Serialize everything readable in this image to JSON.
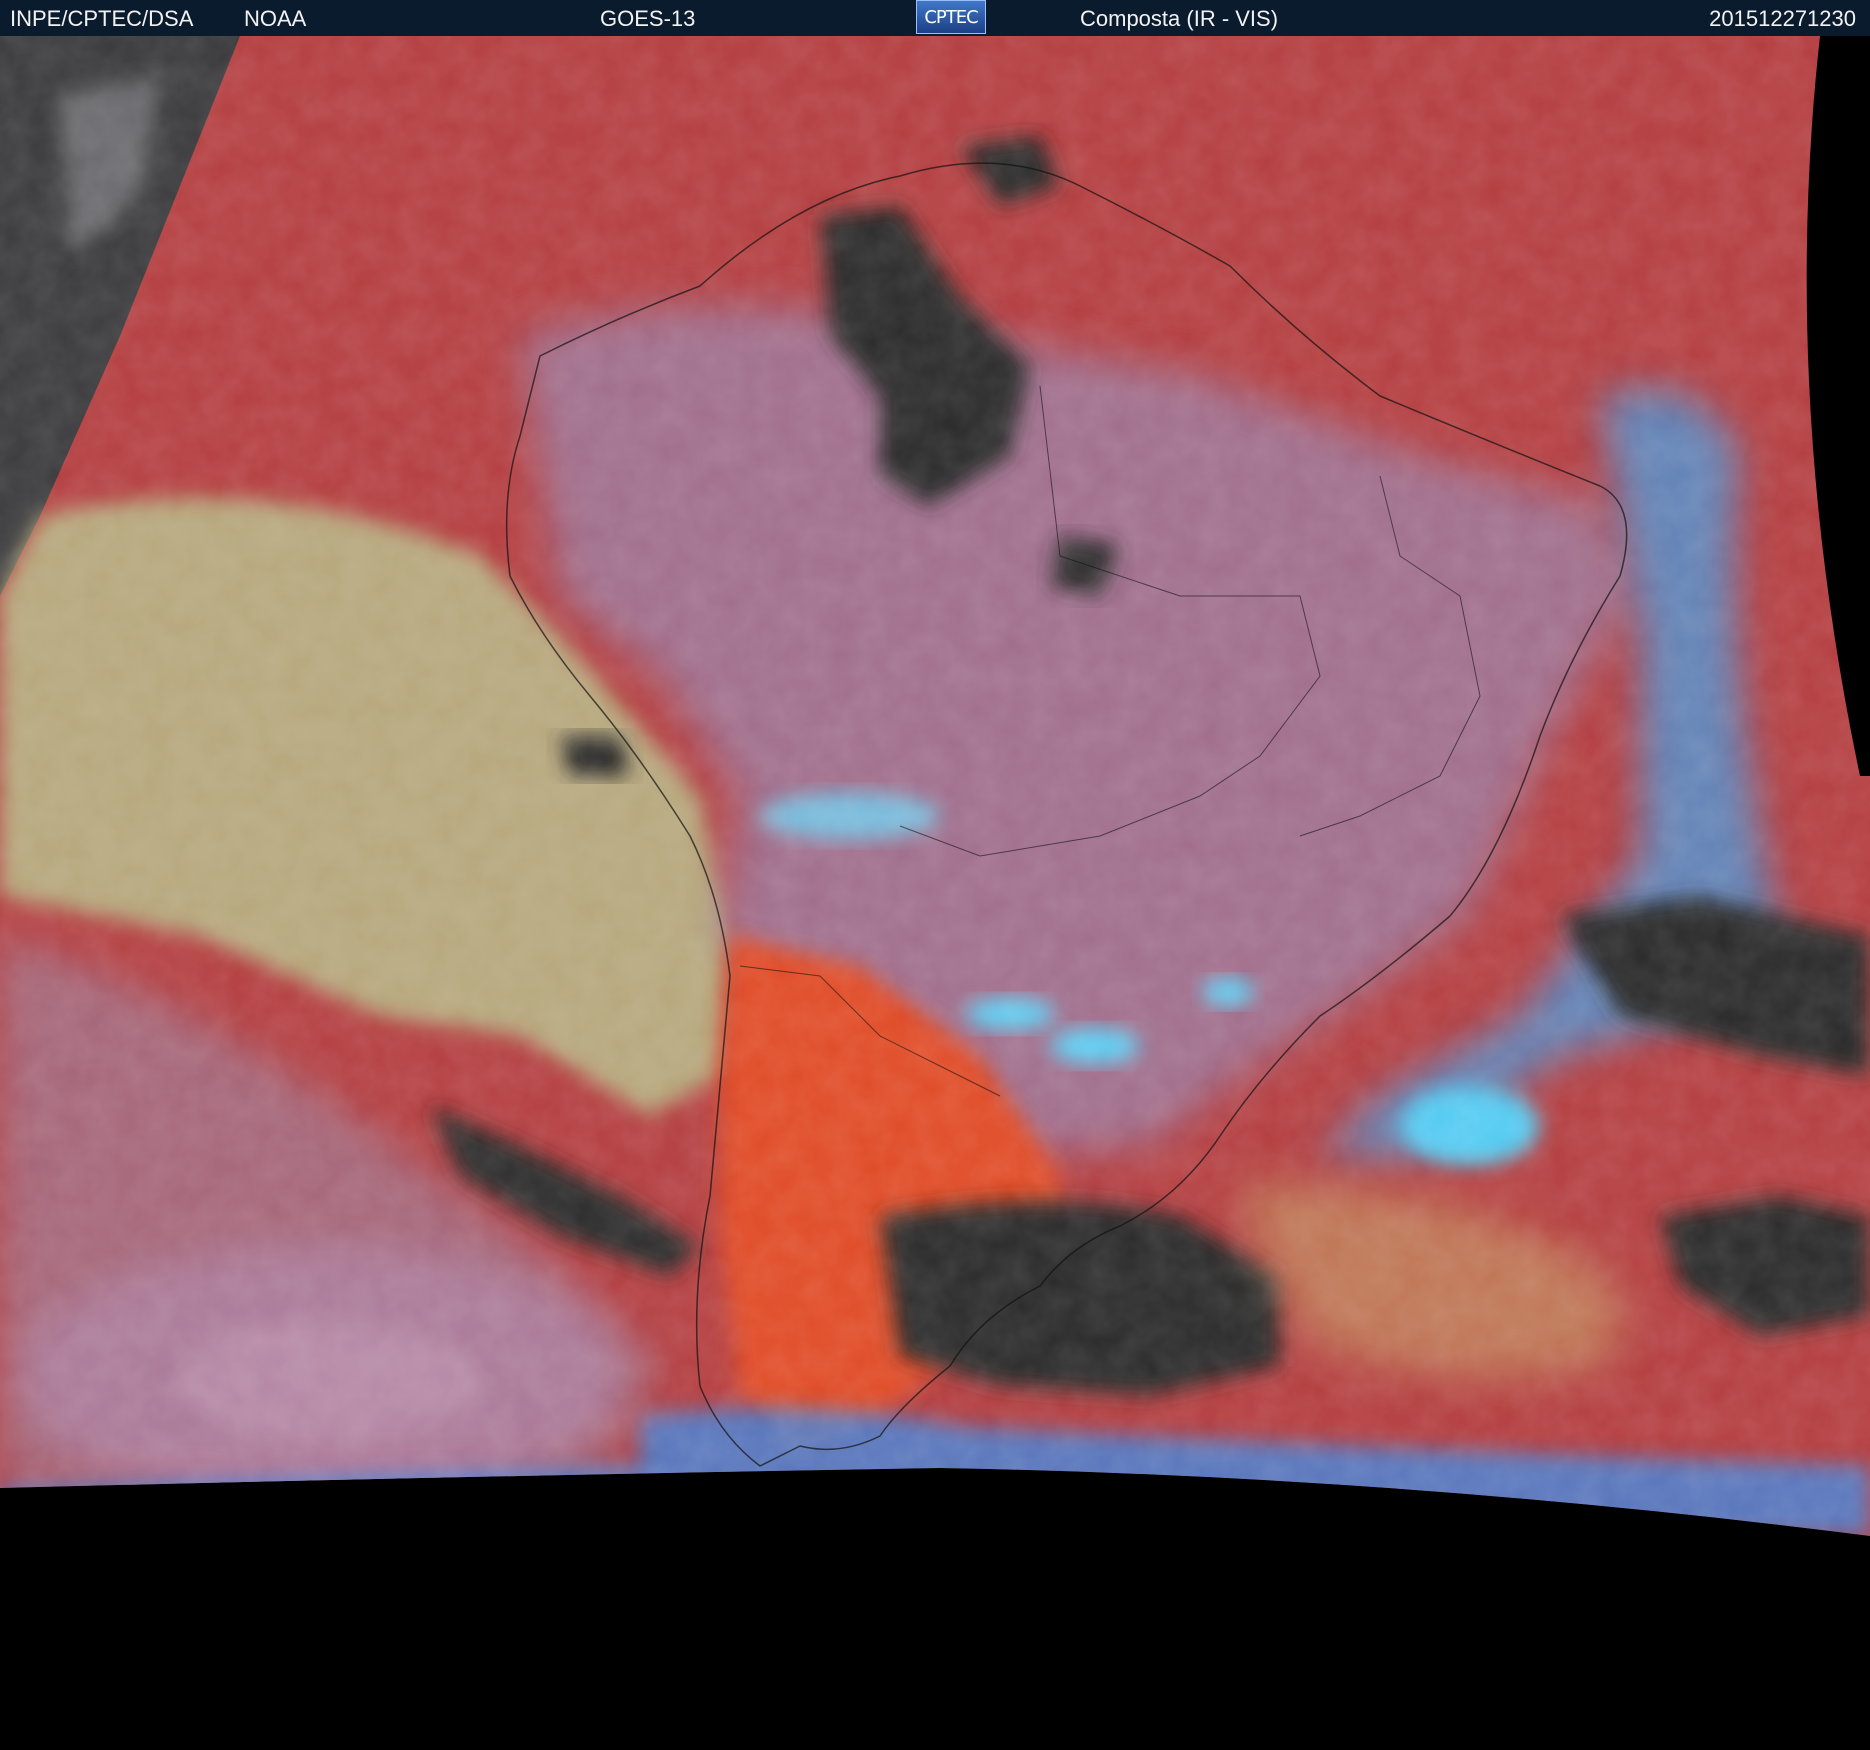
{
  "header": {
    "org": "INPE/CPTEC/DSA",
    "agency": "NOAA",
    "satellite": "GOES-13",
    "logo_text": "CPTEC",
    "product": "Composta (IR - VIS)",
    "timestamp": "201512271230"
  },
  "colors": {
    "background": "#000000",
    "header_bg": "#0b1b2e",
    "clear_sky_red": "#b83c3c",
    "ocean_stratus": "#b5a878",
    "high_cloud_cyan": "#46b7ee",
    "deep_cloud_black": "#2a2a2a",
    "land_orange": "#e04c28"
  }
}
